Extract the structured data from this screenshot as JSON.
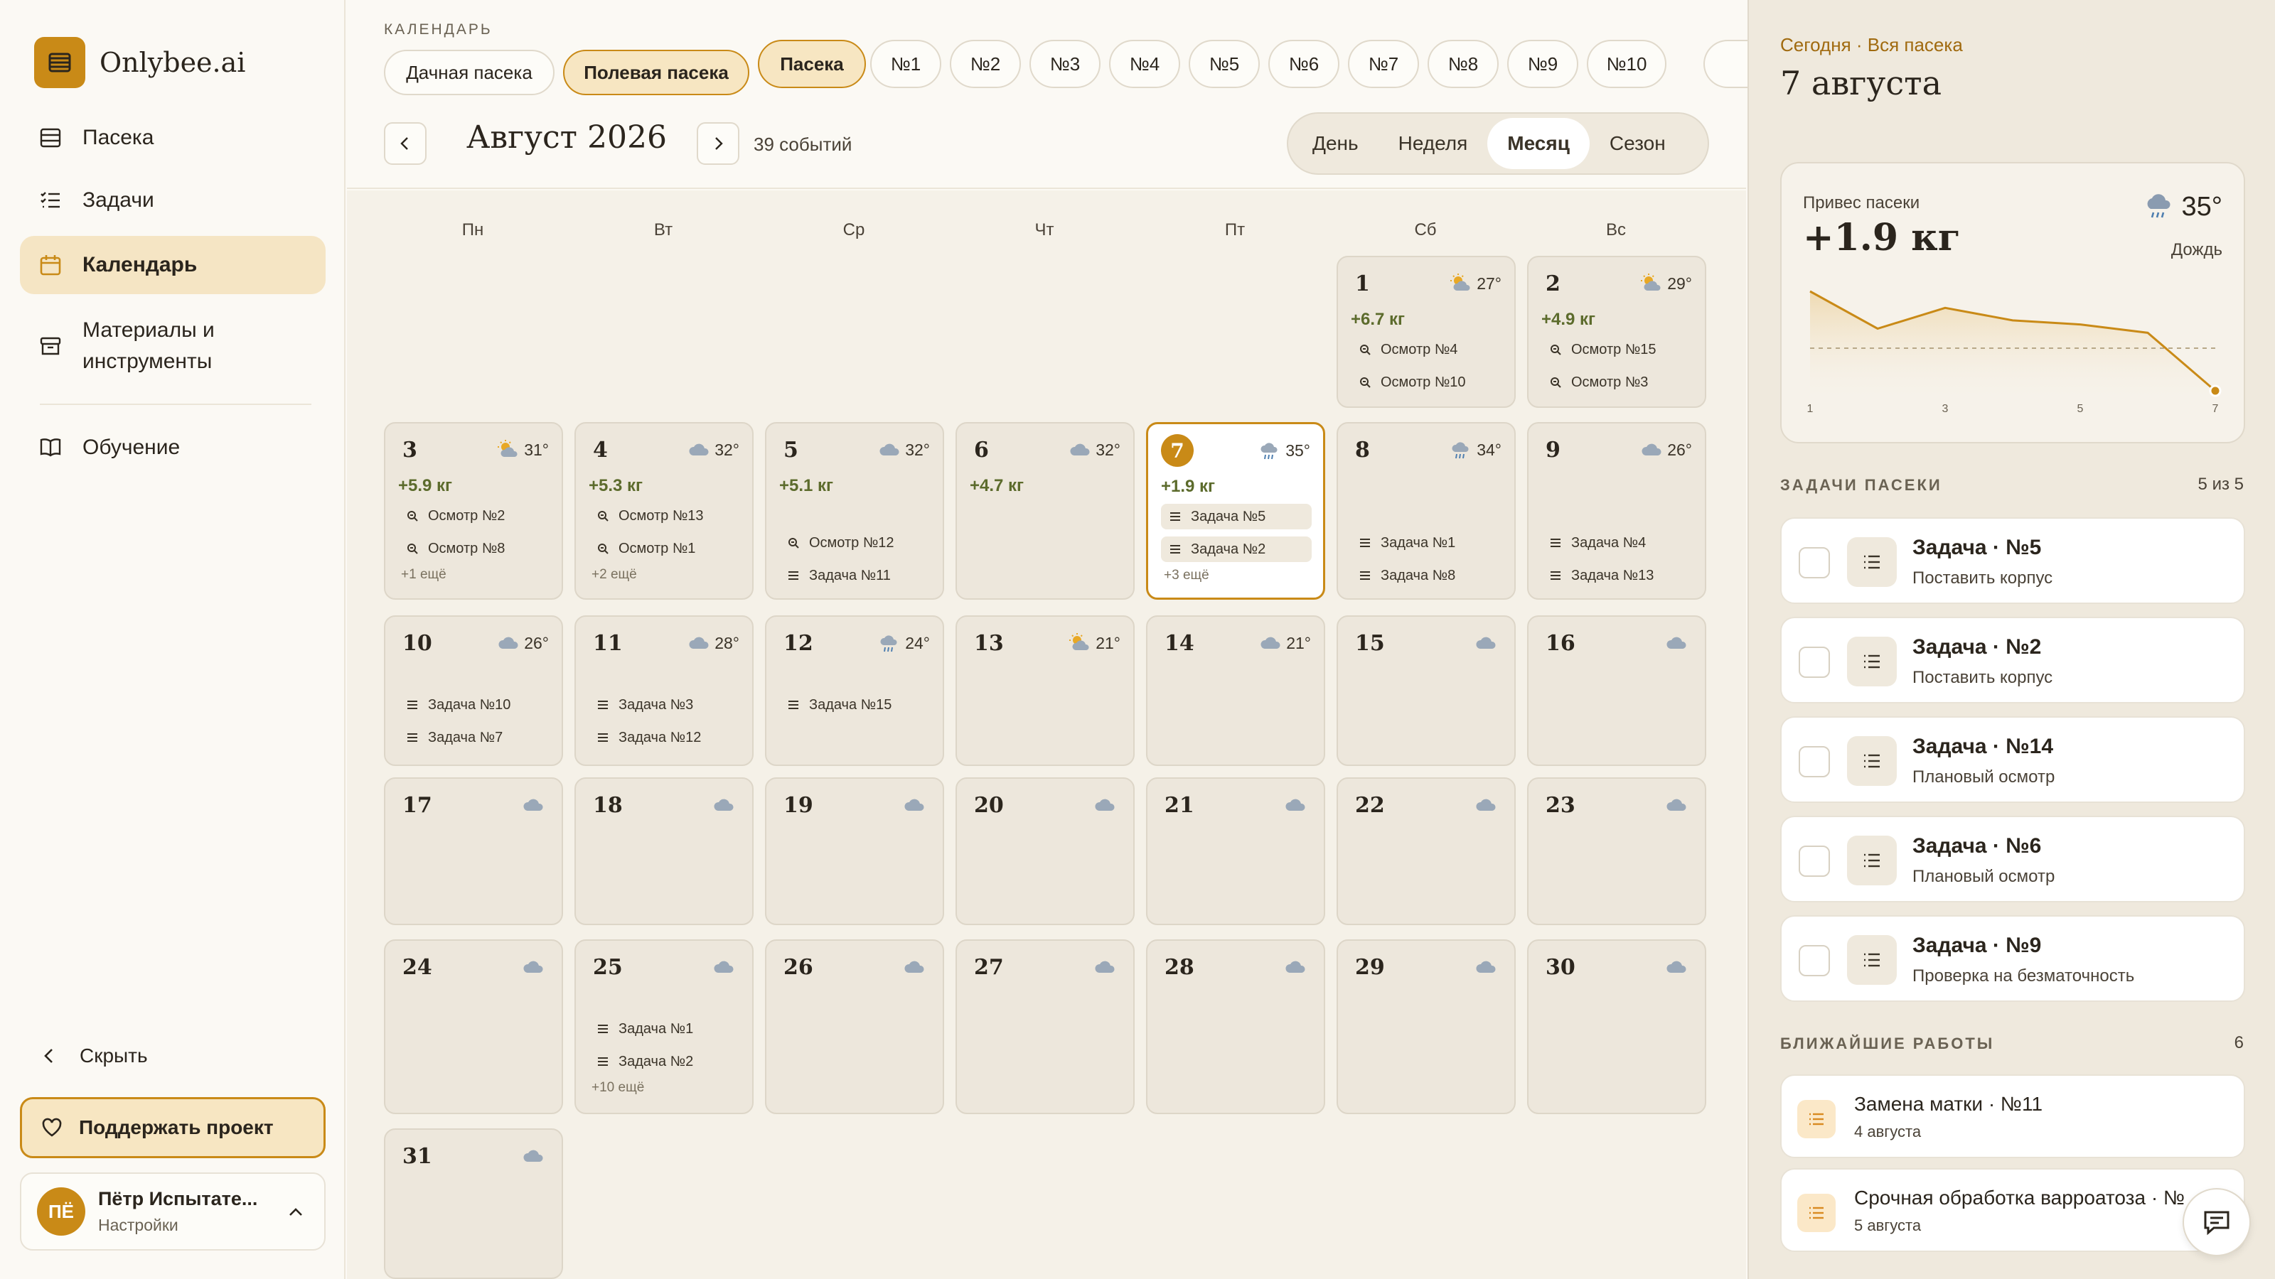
{
  "app": {
    "name": "Onlybee.ai"
  },
  "sidebar": {
    "items": [
      {
        "label": "Пасека",
        "icon": "hive-icon"
      },
      {
        "label": "Задачи",
        "icon": "tasks-icon"
      },
      {
        "label": "Календарь",
        "icon": "calendar-icon",
        "active": true
      },
      {
        "label": "Материалы и инструменты",
        "icon": "box-icon"
      },
      {
        "label": "Обучение",
        "icon": "book-icon"
      }
    ],
    "hide_label": "Скрыть",
    "support_label": "Поддержать проект",
    "user": {
      "initials": "ПЁ",
      "name": "Пётр Испытате...",
      "sub": "Настройки"
    }
  },
  "toolbar": {
    "section_label": "КАЛЕНДАРЬ",
    "apiaries": [
      "Дачная пасека",
      "Полевая пасека"
    ],
    "active_apiary": "Полевая пасека",
    "hives": [
      "Пасека",
      "№1",
      "№2",
      "№3",
      "№4",
      "№5",
      "№6",
      "№7",
      "№8",
      "№9",
      "№10"
    ],
    "month_title": "Август 2026",
    "events_count": "39 событий",
    "views": [
      "День",
      "Неделя",
      "Месяц",
      "Сезон"
    ],
    "active_view": "Месяц"
  },
  "calendar": {
    "weekdays": [
      "Пн",
      "Вт",
      "Ср",
      "Чт",
      "Пт",
      "Сб",
      "Вс"
    ],
    "days": [
      {
        "day": "1",
        "temp": "27°",
        "wx": "sun-cloud",
        "gain": "+6.7 кг",
        "events": [
          {
            "t": "search",
            "l": "Осмотр №4"
          },
          {
            "t": "search",
            "l": "Осмотр №10"
          }
        ]
      },
      {
        "day": "2",
        "temp": "29°",
        "wx": "sun-cloud",
        "gain": "+4.9 кг",
        "events": [
          {
            "t": "search",
            "l": "Осмотр №15"
          },
          {
            "t": "search",
            "l": "Осмотр №3"
          }
        ]
      },
      {
        "day": "3",
        "temp": "31°",
        "wx": "sun-cloud",
        "gain": "+5.9 кг",
        "events": [
          {
            "t": "search",
            "l": "Осмотр №2"
          },
          {
            "t": "search",
            "l": "Осмотр №8"
          }
        ],
        "more": "+1 ещё"
      },
      {
        "day": "4",
        "temp": "32°",
        "wx": "cloud",
        "gain": "+5.3 кг",
        "events": [
          {
            "t": "search",
            "l": "Осмотр №13"
          },
          {
            "t": "search",
            "l": "Осмотр №1"
          }
        ],
        "more": "+2 ещё"
      },
      {
        "day": "5",
        "temp": "32°",
        "wx": "cloud",
        "gain": "+5.1 кг",
        "events": [
          {
            "t": "search",
            "l": "Осмотр №12"
          },
          {
            "t": "list",
            "l": "Задача №11"
          }
        ]
      },
      {
        "day": "6",
        "temp": "32°",
        "wx": "cloud",
        "gain": "+4.7 кг",
        "events": []
      },
      {
        "day": "7",
        "temp": "35°",
        "wx": "rain",
        "gain": "+1.9 кг",
        "today": true,
        "events": [
          {
            "t": "list",
            "l": "Задача №5"
          },
          {
            "t": "list",
            "l": "Задача №2"
          }
        ],
        "more": "+3 ещё"
      },
      {
        "day": "8",
        "temp": "34°",
        "wx": "rain",
        "events": [
          {
            "t": "list",
            "l": "Задача №1"
          },
          {
            "t": "list",
            "l": "Задача №8"
          }
        ]
      },
      {
        "day": "9",
        "temp": "26°",
        "wx": "cloud",
        "events": [
          {
            "t": "list",
            "l": "Задача №4"
          },
          {
            "t": "list",
            "l": "Задача №13"
          }
        ]
      },
      {
        "day": "10",
        "temp": "26°",
        "wx": "cloud",
        "events": [
          {
            "t": "list",
            "l": "Задача №10"
          },
          {
            "t": "list",
            "l": "Задача №7"
          }
        ]
      },
      {
        "day": "11",
        "temp": "28°",
        "wx": "cloud",
        "events": [
          {
            "t": "list",
            "l": "Задача №3"
          },
          {
            "t": "list",
            "l": "Задача №12"
          }
        ]
      },
      {
        "day": "12",
        "temp": "24°",
        "wx": "rain",
        "events": [
          {
            "t": "list",
            "l": "Задача №15"
          }
        ]
      },
      {
        "day": "13",
        "temp": "21°",
        "wx": "sun-cloud",
        "events": []
      },
      {
        "day": "14",
        "temp": "21°",
        "wx": "cloud",
        "events": []
      },
      {
        "day": "15",
        "wx": "cloud",
        "events": []
      },
      {
        "day": "16",
        "wx": "cloud",
        "events": []
      },
      {
        "day": "17",
        "wx": "cloud",
        "events": []
      },
      {
        "day": "18",
        "wx": "cloud",
        "events": []
      },
      {
        "day": "19",
        "wx": "cloud",
        "events": []
      },
      {
        "day": "20",
        "wx": "cloud",
        "events": []
      },
      {
        "day": "21",
        "wx": "cloud",
        "events": []
      },
      {
        "day": "22",
        "wx": "cloud",
        "events": []
      },
      {
        "day": "23",
        "wx": "cloud",
        "events": []
      },
      {
        "day": "24",
        "wx": "cloud",
        "events": []
      },
      {
        "day": "25",
        "wx": "cloud",
        "events": [
          {
            "t": "list",
            "l": "Задача №1"
          },
          {
            "t": "list",
            "l": "Задача №2"
          }
        ],
        "more": "+10 ещё"
      },
      {
        "day": "26",
        "wx": "cloud",
        "events": []
      },
      {
        "day": "27",
        "wx": "cloud",
        "events": []
      },
      {
        "day": "28",
        "wx": "cloud",
        "events": []
      },
      {
        "day": "29",
        "wx": "cloud",
        "events": []
      },
      {
        "day": "30",
        "wx": "cloud",
        "events": []
      },
      {
        "day": "31",
        "wx": "cloud",
        "events": []
      }
    ]
  },
  "panel": {
    "subtitle": "Сегодня · Вся пасека",
    "title": "7 августа",
    "weather": {
      "label": "Привес пасеки",
      "value": "+1.9 кг",
      "temp": "35°",
      "condition": "Дождь",
      "x_ticks": [
        "1",
        "3",
        "5",
        "7"
      ]
    },
    "tasks_header": "ЗАДАЧИ ПАСЕКИ",
    "tasks_count": "5 из 5",
    "tasks": [
      {
        "title": "Задача · №5",
        "sub": "Поставить корпус"
      },
      {
        "title": "Задача · №2",
        "sub": "Поставить корпус"
      },
      {
        "title": "Задача · №14",
        "sub": "Плановый осмотр"
      },
      {
        "title": "Задача · №6",
        "sub": "Плановый осмотр"
      },
      {
        "title": "Задача · №9",
        "sub": "Проверка на безматочность"
      }
    ],
    "works_header": "БЛИЖАЙШИЕ РАБОТЫ",
    "works_count": "6",
    "works": [
      {
        "title": "Замена матки · №11",
        "sub": "4 августа"
      },
      {
        "title": "Срочная обработка варроатоза · №",
        "sub": "5 августа"
      }
    ]
  },
  "chart_data": {
    "type": "line",
    "x": [
      1,
      2,
      3,
      4,
      5,
      6,
      7
    ],
    "series": [
      {
        "values": [
          6.7,
          4.9,
          5.9,
          5.3,
          5.1,
          4.7,
          1.9
        ]
      }
    ],
    "x_ticks": [
      "1",
      "3",
      "5",
      "7"
    ]
  },
  "colors": {
    "accent": "#c98a17",
    "gain": "#5c6b2c",
    "bg": "#fbf9f4"
  }
}
